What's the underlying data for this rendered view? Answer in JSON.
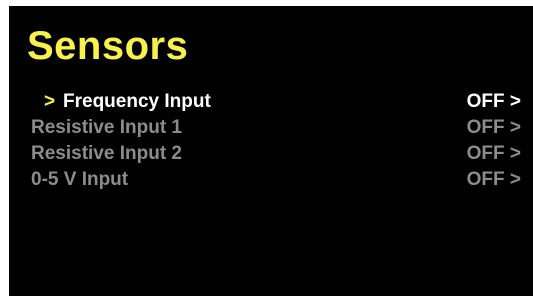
{
  "screen": {
    "title": "Sensors",
    "cursor": ">",
    "colors": {
      "background": "#000000",
      "title": "#f7f04d",
      "cursor": "#f7f04d",
      "selected_text": "#ffffff",
      "unselected_text": "#8c8c8c"
    }
  },
  "menu": {
    "items": [
      {
        "label": "Frequency Input",
        "value": "OFF >",
        "selected": true
      },
      {
        "label": "Resistive Input 1",
        "value": "OFF >",
        "selected": false
      },
      {
        "label": "Resistive Input 2",
        "value": "OFF >",
        "selected": false
      },
      {
        "label": "0-5 V Input",
        "value": "OFF >",
        "selected": false
      }
    ]
  }
}
